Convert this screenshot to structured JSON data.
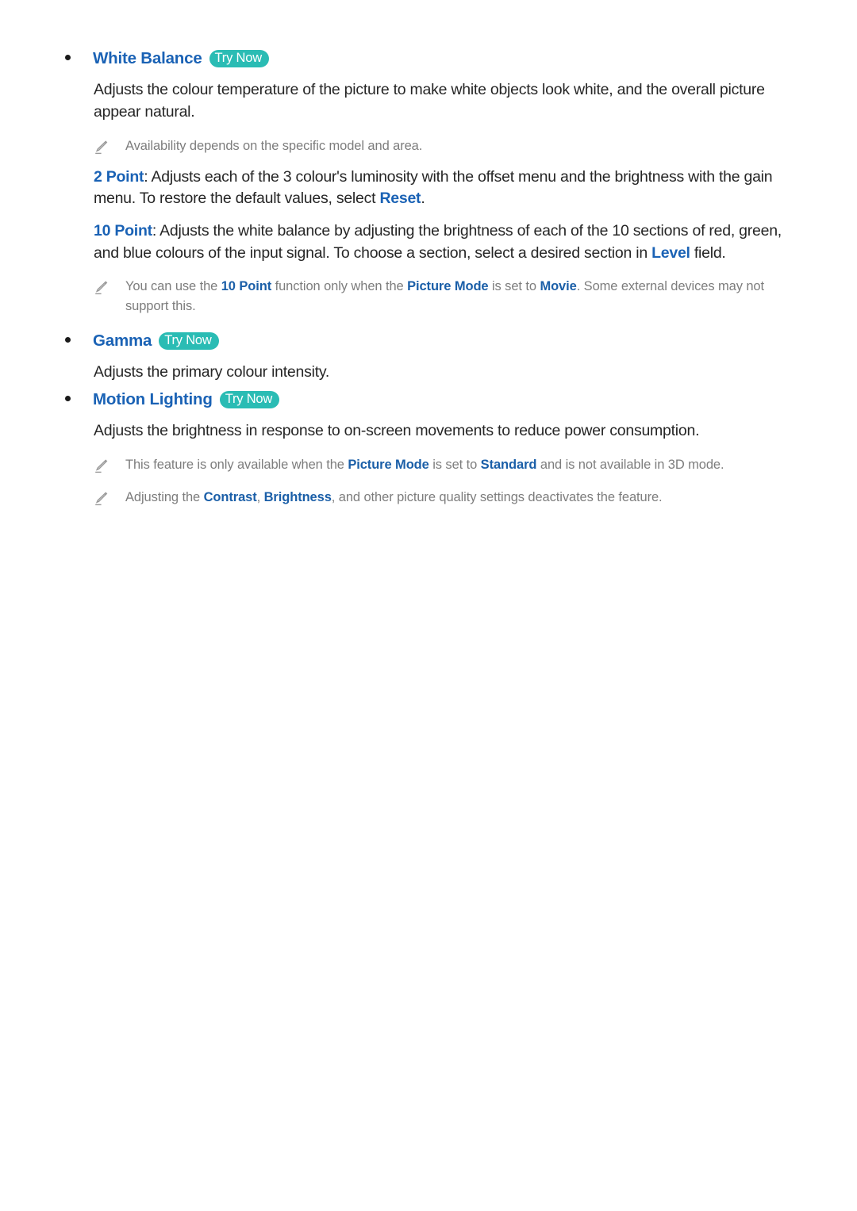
{
  "document": {
    "title": "White Balance / Gamma / Motion Lighting settings help",
    "accent_blue": "#1a62b5",
    "note_blue": "#1b5fa8",
    "badge_teal": "#2abcb4",
    "body_color": "#262626",
    "note_color": "#7d7d7d"
  },
  "try_now_label": "Try Now",
  "note_icon_name": "pencil-note-icon",
  "sections": [
    {
      "id": "white-balance",
      "heading": "White Balance",
      "has_try_now": true,
      "body": "Adjusts the colour temperature of the picture to make white objects look white, and the overall picture appear natural.",
      "note_1": "Availability depends on the specific model and area.",
      "para_2point": {
        "link": "2 Point",
        "rest": ": Adjusts each of the 3 colour's luminosity with the offset menu and the brightness with the gain menu. To restore the default values, select ",
        "link_2": "Reset",
        "tail": "."
      },
      "para_10point": {
        "link": "10 Point",
        "rest": ": Adjusts the white balance by adjusting the brightness of each of the 10 sections of red, green, and blue colours of the input signal. To choose a section, select a desired section in ",
        "link_2": "Level",
        "tail": " field."
      },
      "note_2": {
        "part_1": "You can use the ",
        "link_1": "10 Point",
        "part_2": " function only when the ",
        "link_2": "Picture Mode",
        "part_3": " is set to ",
        "link_3": "Movie",
        "part_4": ". Some external devices may not support this."
      }
    },
    {
      "id": "gamma",
      "heading": "Gamma",
      "has_try_now": true,
      "body": "Adjusts the primary colour intensity."
    },
    {
      "id": "motion-lighting",
      "heading": "Motion Lighting",
      "has_try_now": true,
      "body": "Adjusts the brightness in response to on-screen movements to reduce power consumption.",
      "note_1": {
        "part_1": "This feature is only available when the ",
        "link_1": "Picture Mode",
        "part_2": " is set to ",
        "link_2": "Standard",
        "part_3": " and is not available in 3D mode."
      },
      "note_2": {
        "part_1": "Adjusting the ",
        "link_1": "Contrast",
        "part_2": ", ",
        "link_2": "Brightness",
        "part_3": ", and other picture quality settings deactivates the feature."
      }
    }
  ]
}
